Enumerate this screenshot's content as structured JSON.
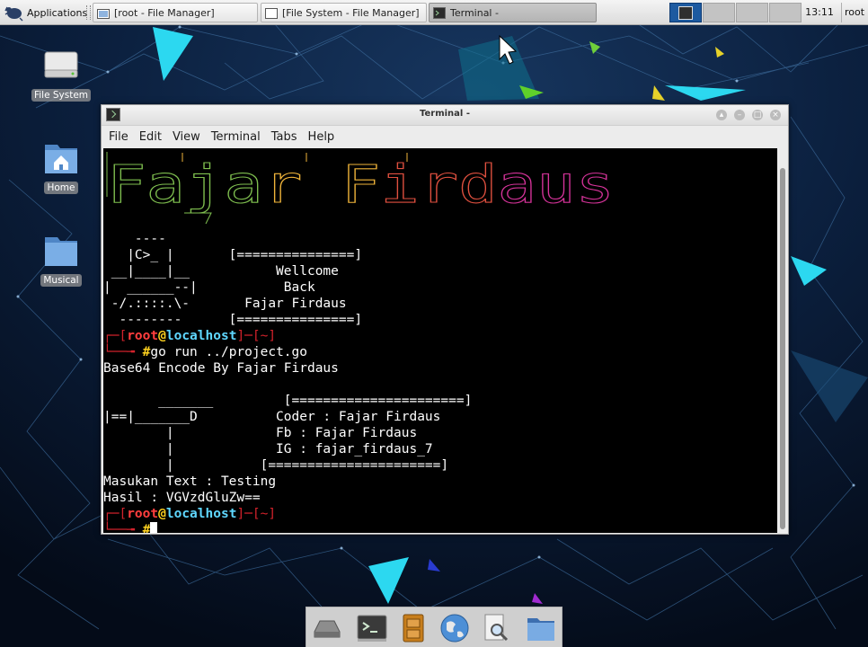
{
  "panel": {
    "applications_label": "Applications",
    "tasks": [
      {
        "label": "[root - File Manager]",
        "icon": "folder-icon",
        "active": false
      },
      {
        "label": "[File System - File Manager]",
        "icon": "file-manager-icon",
        "active": false
      },
      {
        "label": "Terminal -",
        "icon": "terminal-icon",
        "active": true
      }
    ],
    "workspaces": 4,
    "active_workspace": 1,
    "clock": "13:11",
    "user": "root"
  },
  "desktop": {
    "icons": [
      {
        "label": "File System",
        "icon": "drive-icon"
      },
      {
        "label": "Home",
        "icon": "home-folder-icon"
      },
      {
        "label": "Musical",
        "icon": "folder-icon"
      }
    ]
  },
  "window": {
    "title": "Terminal -",
    "menu": [
      "File",
      "Edit",
      "View",
      "Terminal",
      "Tabs",
      "Help"
    ]
  },
  "terminal": {
    "banner_text": "Fajar Firdaus",
    "banner_colors": [
      "#7fbf4f",
      "#f0b43a",
      "#e0503f",
      "#d6339a"
    ],
    "art": [
      "    ----",
      "   |C>_ |       [===============]",
      " __|____|__           Wellcome",
      "|  ______--|           Back",
      " -/.::::.\\-       Fajar Firdaus",
      "  --------      [===============]"
    ],
    "prompt": {
      "user": "root",
      "at": "@",
      "host": "localhost",
      "dir": "~",
      "symbol": "#"
    },
    "command": "go run ../project.go",
    "program_title": "Base64 Encode By Fajar Firdaus",
    "info_block": [
      "",
      "       _______         [======================]",
      "|==|_______D          Coder : Fajar Firdaus",
      "        |             Fb : Fajar Firdaus",
      "        |             IG : fajar_firdaus_7",
      "        |           [======================]"
    ],
    "input_line": "Masukan Text : Testing",
    "result_line": "Hasil : VGVzdGluZw=="
  },
  "dock": {
    "items": [
      "drive-icon",
      "terminal-icon",
      "file-cabinet-icon",
      "web-browser-icon",
      "search-icon",
      "folder-icon"
    ]
  },
  "colors": {
    "wallpaper": "#07142a",
    "accent_cyan": "#2cd8f0",
    "prompt_red": "#d2222b",
    "prompt_user": "#ff3e3e",
    "prompt_host": "#5fd7ff",
    "prompt_symbol": "#ffd21f"
  }
}
